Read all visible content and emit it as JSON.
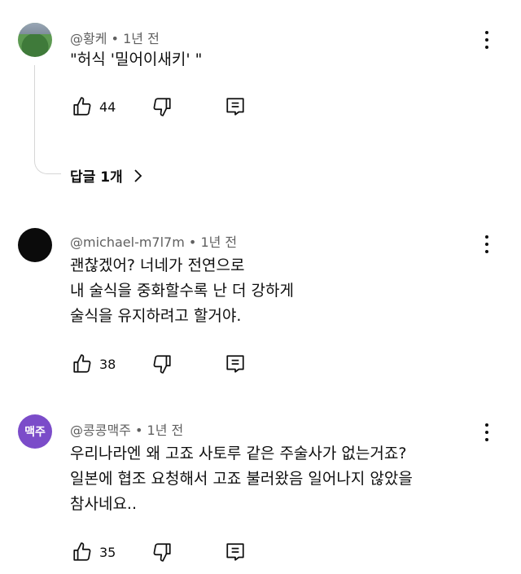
{
  "comments": [
    {
      "handle": "@황케",
      "time": "1년 전",
      "text": "\"허식 '밀어이새키' \"",
      "likes": "44",
      "avatar": "green-photo",
      "replies_label": "답글 1개"
    },
    {
      "handle": "@michael-m7l7m",
      "time": "1년 전",
      "text": "괜찮겠어? 너네가 전연으로\n내 술식을 중화할수록 난 더 강하게\n술식을 유지하려고 할거야.",
      "likes": "38",
      "avatar": "black-circle"
    },
    {
      "handle": "@콩콩맥주",
      "time": "1년 전",
      "text": "우리나라엔 왜 고죠 사토루 같은 주술사가 없는거죠?\n일본에 협조 요청해서 고죠 불러왔음 일어나지 않았을\n참사네요..",
      "likes": "35",
      "avatar_text": "맥주"
    }
  ],
  "colors": {
    "text": "#0f0f0f",
    "meta": "#606060",
    "thread": "#d6d6d6",
    "avatar_purple": "#7b4cc9"
  },
  "icons": [
    "thumb-up-icon",
    "thumb-down-icon",
    "reply-icon",
    "more-vert-icon",
    "chevron-right-icon"
  ]
}
